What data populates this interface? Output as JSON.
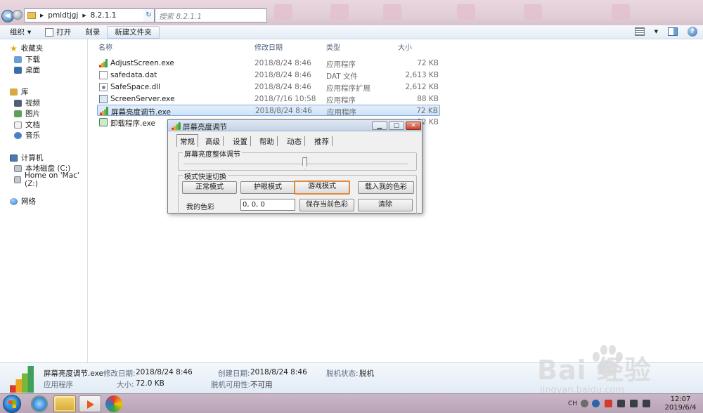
{
  "address": {
    "crumbs": [
      "pmldtjgj",
      "8.2.1.1"
    ],
    "sep": "▸"
  },
  "search": {
    "placeholder": "搜索 8.2.1.1"
  },
  "toolbar": {
    "organize": "组织",
    "open": "打开",
    "burn": "刻录",
    "new_folder": "新建文件夹",
    "dropdown": "▾",
    "help": "?"
  },
  "nav": {
    "favorites": "收藏夹",
    "downloads": "下载",
    "desktop": "桌面",
    "libraries": "库",
    "videos": "视频",
    "pictures": "图片",
    "documents": "文档",
    "music": "音乐",
    "computer": "计算机",
    "local_disk": "本地磁盘 (C:)",
    "mac_home": "Home on 'Mac' (Z:)",
    "network": "网络"
  },
  "columns": {
    "name": "名称",
    "modified": "修改日期",
    "type": "类型",
    "size": "大小"
  },
  "files": [
    {
      "name": "AdjustScreen.exe",
      "modified": "2018/8/24 8:46",
      "type": "应用程序",
      "size": "72 KB",
      "icon": "bars-icon"
    },
    {
      "name": "safedata.dat",
      "modified": "2018/8/24 8:46",
      "type": "DAT 文件",
      "size": "2,613 KB",
      "icon": "file-icon"
    },
    {
      "name": "SafeSpace.dll",
      "modified": "2018/8/24 8:46",
      "type": "应用程序扩展",
      "size": "2,612 KB",
      "icon": "dll-icon"
    },
    {
      "name": "ScreenServer.exe",
      "modified": "2018/7/16 10:58",
      "type": "应用程序",
      "size": "88 KB",
      "icon": "app-icon"
    },
    {
      "name": "屏幕亮度调节.exe",
      "modified": "2018/8/24 8:46",
      "type": "应用程序",
      "size": "72 KB",
      "icon": "bars-icon"
    },
    {
      "name": "卸载程序.exe",
      "modified": "",
      "type": "",
      "size": "32 KB",
      "icon": "uninstall-icon"
    }
  ],
  "dialog": {
    "title": "屏幕亮度调节",
    "min": "▁",
    "max": "▢",
    "close": "✕",
    "tabs": [
      "常规",
      "高级",
      "设置",
      "帮助",
      "动态",
      "推荐"
    ],
    "brightness_group": "屏幕亮度整体调节",
    "brightness_level": 0.54,
    "mode_group": "模式快速切换",
    "modes": [
      "正常模式",
      "护眼模式",
      "游戏模式",
      "载入我的色彩"
    ],
    "my_color_label": "我的色彩",
    "my_color_value": "0, 0, 0",
    "save_color": "保存当前色彩",
    "clear": "清除"
  },
  "details": {
    "name": "屏幕亮度调节.exe",
    "kind": "应用程序",
    "modified_label": "修改日期:",
    "modified": "2018/8/24 8:46",
    "size_label": "大小:",
    "size": "72.0 KB",
    "created_label": "创建日期:",
    "created": "2018/8/24 8:46",
    "offline_label": "脱机可用性:",
    "offline": "不可用",
    "offline_status_label": "脱机状态:",
    "offline_status": "脱机"
  },
  "taskbar": {
    "lang": "CH",
    "clock_time": "12:07",
    "clock_date": "2019/6/4"
  },
  "watermark": {
    "text": "Bai 经验",
    "sub": "jingyan.baidu.com"
  }
}
